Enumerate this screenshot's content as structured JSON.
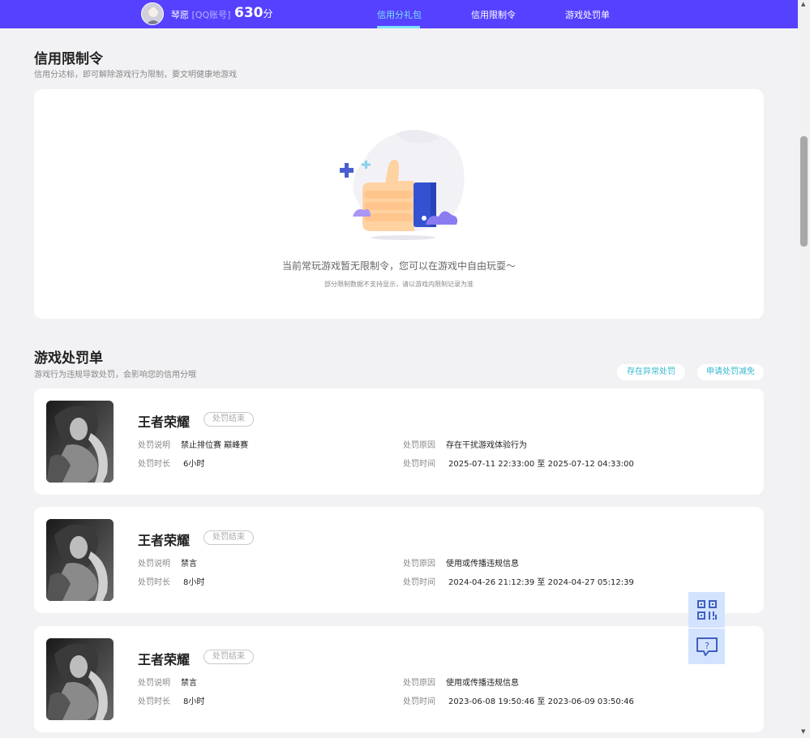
{
  "header": {
    "username": "琴愿",
    "account_type": "[QQ账号]",
    "score": "630",
    "score_unit": "分",
    "nav": [
      {
        "label": "信用分礼包",
        "active": true
      },
      {
        "label": "信用限制令",
        "active": false
      },
      {
        "label": "游戏处罚单",
        "active": false
      }
    ]
  },
  "restriction": {
    "title": "信用限制令",
    "subtitle": "信用分达标，即可解除游戏行为限制，要文明健康地游戏",
    "empty_message": "当前常玩游戏暂无限制令，您可以在游戏中自由玩耍～",
    "empty_note": "部分限制数据不支持显示，请以游戏内限制记录为准"
  },
  "penalties": {
    "title": "游戏处罚单",
    "subtitle": "游戏行为违规导致处罚，会影响您的信用分哦",
    "btn_abnormal": "存在异常处罚",
    "btn_reduce": "申请处罚减免",
    "labels": {
      "desc": "处罚说明",
      "duration": "处罚时长",
      "reason": "处罚原因",
      "time": "处罚时间",
      "to": "至"
    },
    "items": [
      {
        "game": "王者荣耀",
        "status": "处罚结束",
        "desc": "禁止排位赛 巅峰赛",
        "duration": "6小时",
        "reason": "存在干扰游戏体验行为",
        "start": "2025-07-11 22:33:00",
        "end": "2025-07-12 04:33:00"
      },
      {
        "game": "王者荣耀",
        "status": "处罚结束",
        "desc": "禁言",
        "duration": "8小时",
        "reason": "使用或传播违规信息",
        "start": "2024-04-26 21:12:39",
        "end": "2024-04-27 05:12:39"
      },
      {
        "game": "王者荣耀",
        "status": "处罚结束",
        "desc": "禁言",
        "duration": "8小时",
        "reason": "使用或传播违规信息",
        "start": "2023-06-08 19:50:46",
        "end": "2023-06-09 03:50:46"
      }
    ]
  },
  "float_buttons": {
    "qr": "qrcode-icon",
    "help": "help-chat-icon"
  },
  "colors": {
    "brand": "#5541ff",
    "accent": "#7ee0ff",
    "link": "#35b7d0"
  }
}
